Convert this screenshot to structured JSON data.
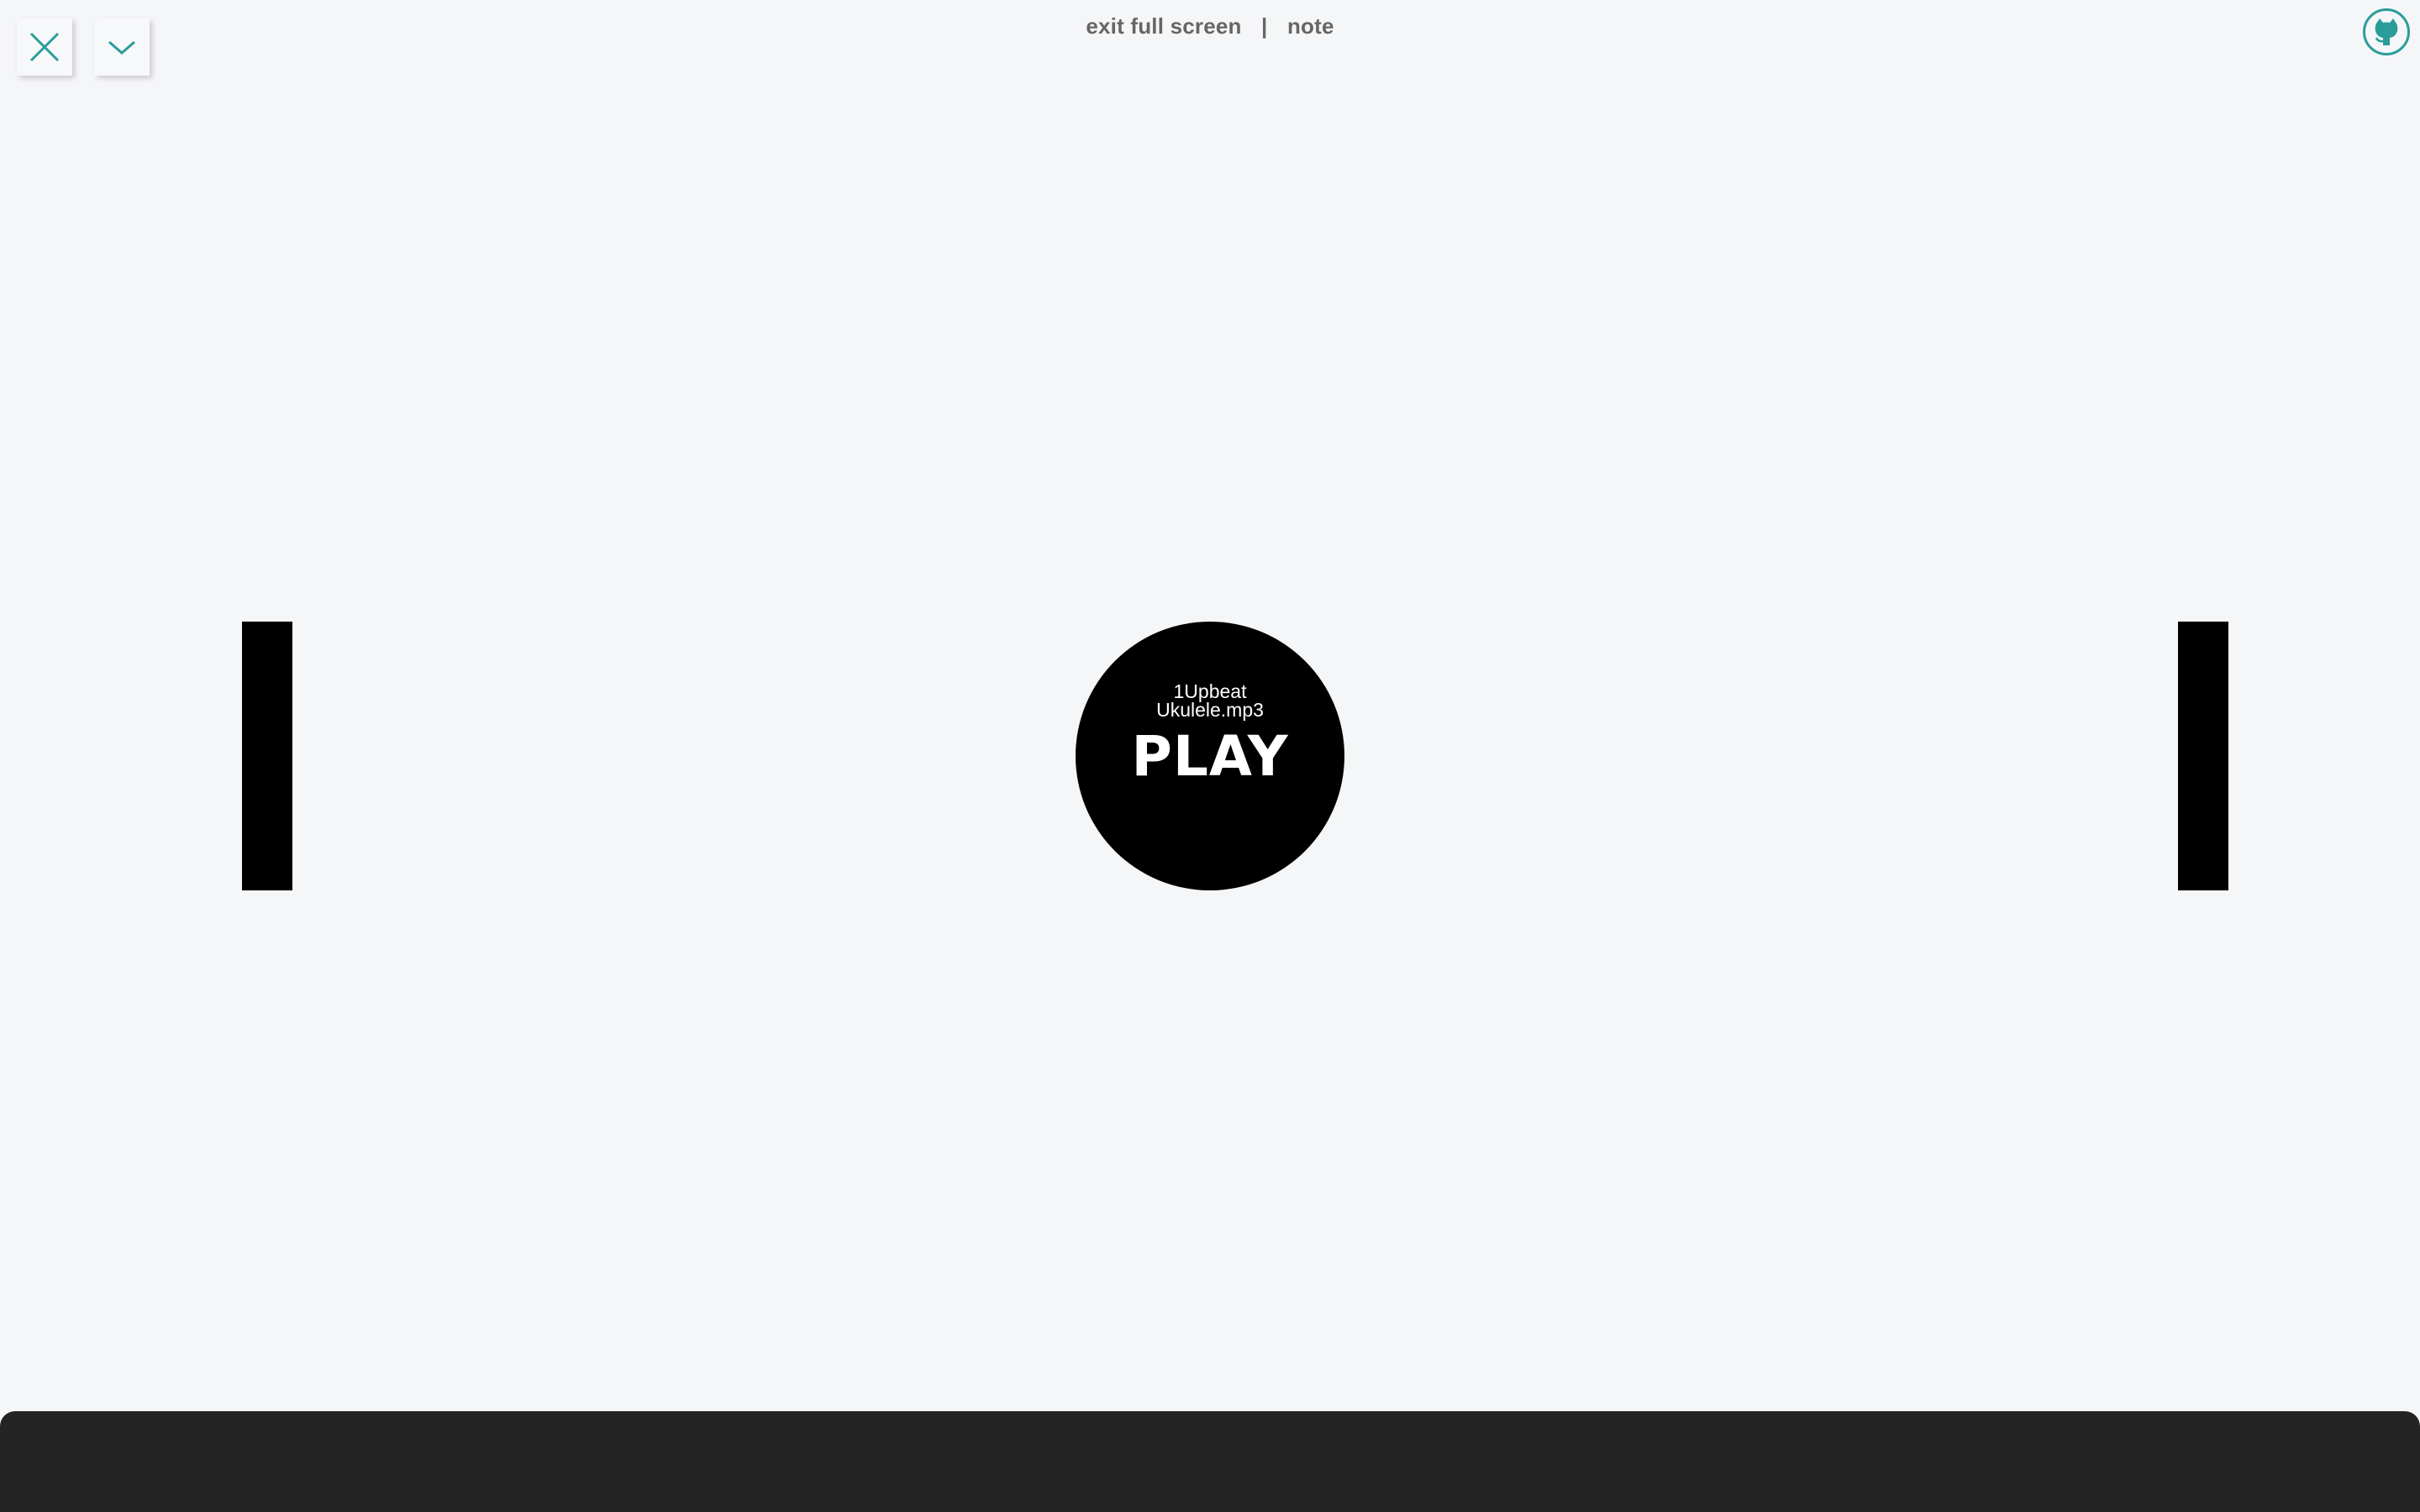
{
  "header": {
    "exit_label": "exit full screen",
    "separator": "|",
    "note_label": "note"
  },
  "controls": {
    "close_icon": "close-icon",
    "toggle_icon": "chevron-down-icon",
    "github_icon": "github-icon"
  },
  "player": {
    "track_line1": "1Upbeat",
    "track_line2": "Ukulele.mp3",
    "play_label": "PLAY"
  },
  "colors": {
    "accent": "#2a9d9a",
    "background": "#f5f6f8",
    "ball": "#000000",
    "paddle": "#000000",
    "bottom_bar": "#242424",
    "header_text": "#666666"
  }
}
